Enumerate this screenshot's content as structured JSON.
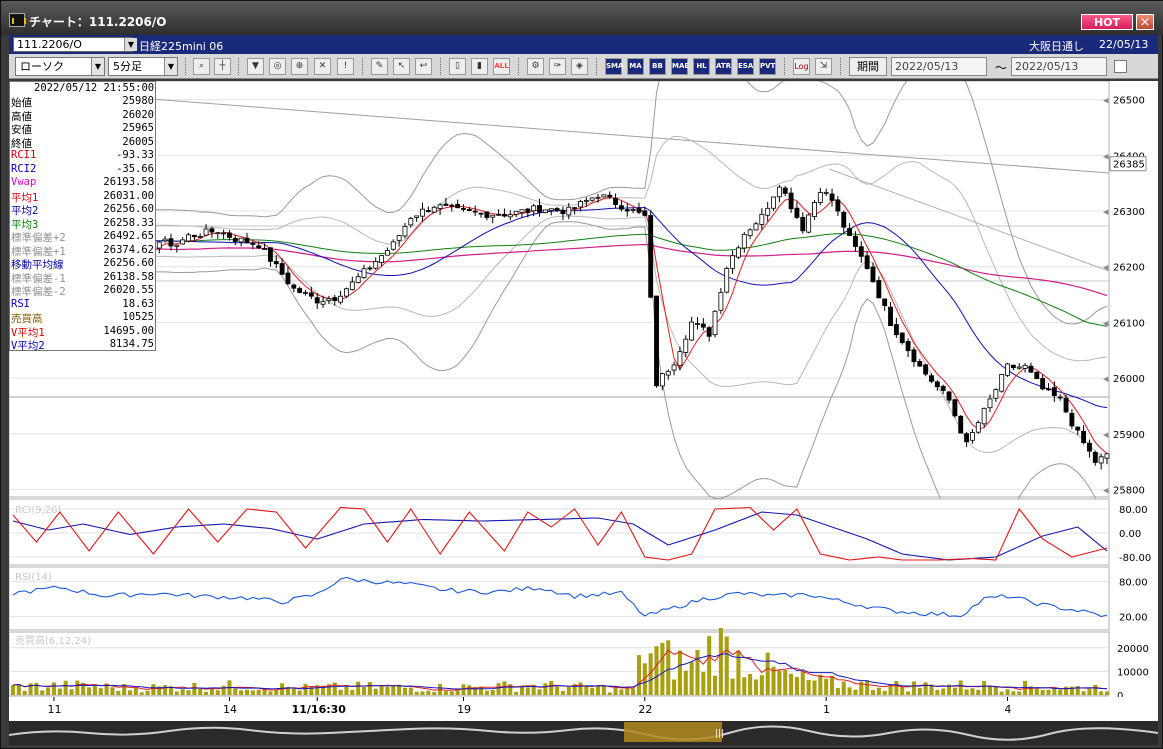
{
  "window": {
    "title": "チャート：111.2206/O",
    "hot_label": "HOT",
    "close_label": "×"
  },
  "symbol_bar": {
    "code": "111.2206/O",
    "name": "日経225mini 06",
    "market": "大阪日通し",
    "date": "22/05/13"
  },
  "toolbar": {
    "chart_type": "ローソク",
    "timeframe": "5分足",
    "period_label": "期間",
    "date_from": "2022/05/13",
    "tilde": "～",
    "date_to": "2022/05/13",
    "buttons": [
      "MA",
      "BB",
      "MAE",
      "HL",
      "ATR",
      "ESA",
      "PVT",
      "Log",
      "ALL"
    ]
  },
  "info_panel": {
    "timestamp": "2022/05/12  21:55:00",
    "rows": [
      {
        "k": "始値",
        "v": "25980",
        "c": "#000000"
      },
      {
        "k": "高値",
        "v": "26020",
        "c": "#000000"
      },
      {
        "k": "安値",
        "v": "25965",
        "c": "#000000"
      },
      {
        "k": "終値",
        "v": "26005",
        "c": "#000000"
      },
      {
        "k": "RCI1",
        "v": "-93.33",
        "c": "#d40000"
      },
      {
        "k": "RCI2",
        "v": "-35.66",
        "c": "#0000c0"
      },
      {
        "k": "Vwap",
        "v": "26193.58",
        "c": "#e000e0"
      },
      {
        "k": "平均1",
        "v": "26031.00",
        "c": "#d40000"
      },
      {
        "k": "平均2",
        "v": "26256.60",
        "c": "#0000a0"
      },
      {
        "k": "平均3",
        "v": "26258.33",
        "c": "#008000"
      },
      {
        "k": "標準偏差+2",
        "v": "26492.65",
        "c": "#909090"
      },
      {
        "k": "標準偏差+1",
        "v": "26374.62",
        "c": "#909090"
      },
      {
        "k": "移動平均線",
        "v": "26256.60",
        "c": "#0000a0"
      },
      {
        "k": "標準偏差-1",
        "v": "26138.58",
        "c": "#909090"
      },
      {
        "k": "標準偏差-2",
        "v": "26020.55",
        "c": "#909090"
      },
      {
        "k": "RSI",
        "v": "18.63",
        "c": "#0000c0"
      },
      {
        "k": "売買高",
        "v": "10525",
        "c": "#806000"
      },
      {
        "k": "V平均1",
        "v": "14695.00",
        "c": "#d40000"
      },
      {
        "k": "V平均2",
        "v": "8134.75",
        "c": "#0000c0"
      }
    ]
  },
  "chart_data": {
    "type": "candlestick",
    "x_tick_labels": [
      {
        "label": "11",
        "idx": 7
      },
      {
        "label": "14",
        "idx": 37
      },
      {
        "label": "11/16:30",
        "idx": 52
      },
      {
        "label": "19",
        "idx": 77
      },
      {
        "label": "22",
        "idx": 108
      },
      {
        "label": "1",
        "idx": 139
      },
      {
        "label": "4",
        "idx": 170
      }
    ],
    "price_axis": {
      "ylim": [
        25790,
        26530
      ],
      "ticks": [
        25800,
        25900,
        26000,
        26100,
        26200,
        26300,
        26400,
        26500
      ],
      "current": 26385
    },
    "rci_panel": {
      "title": "RCI(9,26)",
      "ylim": [
        -100,
        100
      ],
      "ticks": [
        "80.00",
        "0.00",
        "-80.00"
      ]
    },
    "rsi_panel": {
      "title": "RSI(14)",
      "ylim": [
        0,
        100
      ],
      "ticks": [
        "80.00",
        "20.00"
      ]
    },
    "volume_panel": {
      "title": "売買高(6,12,24)",
      "ylim": [
        0,
        25000
      ],
      "ticks": [
        "20000",
        "10000",
        "0"
      ]
    },
    "price_anchors": [
      [
        0,
        26245
      ],
      [
        5,
        26260
      ],
      [
        10,
        26270
      ],
      [
        15,
        26250
      ],
      [
        18,
        26220
      ],
      [
        20,
        26215
      ],
      [
        22,
        26230
      ],
      [
        25,
        26245
      ],
      [
        28,
        26240
      ],
      [
        30,
        26255
      ],
      [
        35,
        26265
      ],
      [
        38,
        26250
      ],
      [
        42,
        26240
      ],
      [
        48,
        26160
      ],
      [
        52,
        26140
      ],
      [
        55,
        26145
      ],
      [
        58,
        26170
      ],
      [
        62,
        26210
      ],
      [
        65,
        26240
      ],
      [
        68,
        26290
      ],
      [
        72,
        26310
      ],
      [
        76,
        26300
      ],
      [
        80,
        26295
      ],
      [
        85,
        26295
      ],
      [
        90,
        26305
      ],
      [
        95,
        26300
      ],
      [
        100,
        26330
      ],
      [
        104,
        26310
      ],
      [
        108,
        26290
      ],
      [
        110,
        25990
      ],
      [
        113,
        26030
      ],
      [
        116,
        26100
      ],
      [
        119,
        26080
      ],
      [
        122,
        26200
      ],
      [
        125,
        26260
      ],
      [
        128,
        26290
      ],
      [
        131,
        26350
      ],
      [
        135,
        26270
      ],
      [
        138,
        26340
      ],
      [
        140,
        26320
      ],
      [
        143,
        26250
      ],
      [
        146,
        26200
      ],
      [
        150,
        26100
      ],
      [
        155,
        26020
      ],
      [
        160,
        25960
      ],
      [
        163,
        25880
      ],
      [
        166,
        25940
      ],
      [
        170,
        26020
      ],
      [
        173,
        26020
      ],
      [
        176,
        25980
      ],
      [
        179,
        25960
      ],
      [
        182,
        25900
      ],
      [
        185,
        25850
      ],
      [
        187,
        25860
      ]
    ],
    "volume_anchors": [
      [
        0,
        3500
      ],
      [
        10,
        4000
      ],
      [
        20,
        3000
      ],
      [
        30,
        3500
      ],
      [
        40,
        4000
      ],
      [
        50,
        3000
      ],
      [
        60,
        3500
      ],
      [
        70,
        3000
      ],
      [
        80,
        3500
      ],
      [
        90,
        4000
      ],
      [
        100,
        3000
      ],
      [
        106,
        2500
      ],
      [
        108,
        20000
      ],
      [
        112,
        15000
      ],
      [
        116,
        12000
      ],
      [
        120,
        22000
      ],
      [
        124,
        16000
      ],
      [
        128,
        12000
      ],
      [
        132,
        8000
      ],
      [
        136,
        6000
      ],
      [
        140,
        5000
      ],
      [
        150,
        4000
      ],
      [
        160,
        4000
      ],
      [
        170,
        4000
      ],
      [
        180,
        3000
      ],
      [
        187,
        3500
      ]
    ],
    "rsi_anchors": [
      [
        0,
        60
      ],
      [
        8,
        70
      ],
      [
        16,
        55
      ],
      [
        24,
        60
      ],
      [
        32,
        55
      ],
      [
        40,
        52
      ],
      [
        46,
        45
      ],
      [
        52,
        58
      ],
      [
        56,
        85
      ],
      [
        62,
        80
      ],
      [
        68,
        75
      ],
      [
        74,
        65
      ],
      [
        82,
        62
      ],
      [
        90,
        70
      ],
      [
        96,
        55
      ],
      [
        104,
        60
      ],
      [
        108,
        20
      ],
      [
        112,
        32
      ],
      [
        118,
        50
      ],
      [
        124,
        60
      ],
      [
        130,
        55
      ],
      [
        136,
        58
      ],
      [
        142,
        45
      ],
      [
        150,
        30
      ],
      [
        156,
        25
      ],
      [
        162,
        22
      ],
      [
        166,
        50
      ],
      [
        170,
        55
      ],
      [
        176,
        40
      ],
      [
        182,
        30
      ],
      [
        187,
        20
      ]
    ],
    "rci_fast_anchors": [
      [
        0,
        60
      ],
      [
        4,
        -30
      ],
      [
        8,
        70
      ],
      [
        13,
        -60
      ],
      [
        18,
        70
      ],
      [
        24,
        -70
      ],
      [
        30,
        80
      ],
      [
        35,
        -30
      ],
      [
        40,
        80
      ],
      [
        45,
        70
      ],
      [
        50,
        -50
      ],
      [
        56,
        85
      ],
      [
        60,
        80
      ],
      [
        64,
        -30
      ],
      [
        68,
        80
      ],
      [
        73,
        -70
      ],
      [
        78,
        70
      ],
      [
        84,
        -60
      ],
      [
        88,
        70
      ],
      [
        92,
        20
      ],
      [
        96,
        80
      ],
      [
        100,
        -40
      ],
      [
        104,
        70
      ],
      [
        108,
        -80
      ],
      [
        112,
        -90
      ],
      [
        116,
        -70
      ],
      [
        120,
        80
      ],
      [
        126,
        85
      ],
      [
        130,
        10
      ],
      [
        134,
        80
      ],
      [
        138,
        -70
      ],
      [
        143,
        -90
      ],
      [
        148,
        -80
      ],
      [
        152,
        -90
      ],
      [
        158,
        -90
      ],
      [
        164,
        -85
      ],
      [
        168,
        -90
      ],
      [
        172,
        80
      ],
      [
        176,
        -20
      ],
      [
        181,
        -80
      ],
      [
        187,
        -50
      ]
    ],
    "rci_slow_anchors": [
      [
        0,
        40
      ],
      [
        6,
        10
      ],
      [
        12,
        30
      ],
      [
        20,
        -5
      ],
      [
        28,
        20
      ],
      [
        36,
        30
      ],
      [
        44,
        15
      ],
      [
        52,
        -20
      ],
      [
        60,
        30
      ],
      [
        70,
        45
      ],
      [
        80,
        40
      ],
      [
        90,
        45
      ],
      [
        100,
        50
      ],
      [
        106,
        30
      ],
      [
        112,
        -40
      ],
      [
        120,
        10
      ],
      [
        128,
        70
      ],
      [
        134,
        60
      ],
      [
        140,
        20
      ],
      [
        146,
        -20
      ],
      [
        152,
        -70
      ],
      [
        160,
        -90
      ],
      [
        168,
        -80
      ],
      [
        176,
        -10
      ],
      [
        182,
        20
      ],
      [
        187,
        -60
      ]
    ]
  }
}
